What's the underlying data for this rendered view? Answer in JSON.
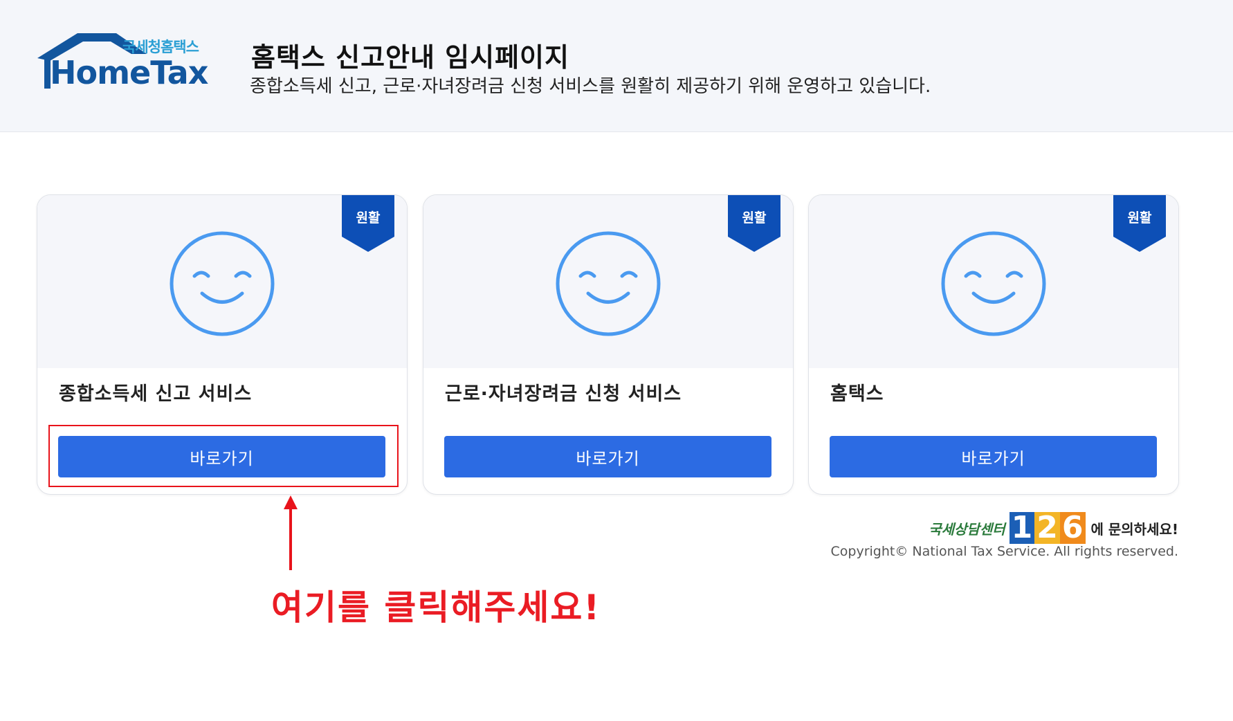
{
  "header": {
    "logo_kr": "국세청홈택스",
    "logo_en": "HomeTax",
    "title": "홈택스 신고안내 임시페이지",
    "subtitle": "종합소득세 신고, 근로·자녀장려금 신청 서비스를 원활히 제공하기 위해 운영하고 있습니다."
  },
  "cards": [
    {
      "status": "원활",
      "title": "종합소득세 신고 서비스",
      "button": "바로가기"
    },
    {
      "status": "원활",
      "title": "근로·자녀장려금 신청 서비스",
      "button": "바로가기"
    },
    {
      "status": "원활",
      "title": "홈택스",
      "button": "바로가기"
    }
  ],
  "annotation": {
    "text": "여기를 클릭해주세요!",
    "color": "#ea1c24"
  },
  "footer": {
    "center_name": "국세상담센터",
    "center_number": [
      "1",
      "2",
      "6"
    ],
    "center_ask": "에 문의하세요!",
    "copyright": "Copyright© National Tax Service. All rights reserved."
  },
  "colors": {
    "accent": "#2c6be3",
    "ribbon": "#0d4fb6",
    "smiley": "#4a9af0"
  }
}
